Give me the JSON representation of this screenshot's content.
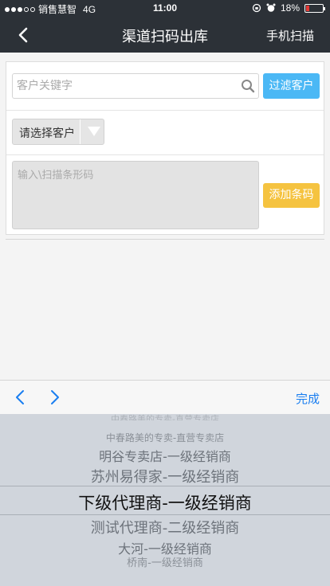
{
  "status_bar": {
    "carrier": "销售慧智",
    "network": "4G",
    "time": "11:00",
    "battery": "18%"
  },
  "nav": {
    "title": "渠道扫码出库",
    "right_action": "手机扫描"
  },
  "form": {
    "search_placeholder": "客户关键字",
    "filter_button": "过滤客户",
    "customer_select": "请选择客户",
    "barcode_placeholder": "输入\\扫描条形码",
    "add_barcode_button": "添加条码"
  },
  "toolbar": {
    "done_label": "完成"
  },
  "picker": {
    "items": [
      "中春路美的专卖-直营专卖店",
      "中春路美的专卖-直营专卖店",
      "明谷专卖店-一级经销商",
      "苏州易得家-一级经销商",
      "下级代理商-一级经销商",
      "测试代理商-二级经销商",
      "大河-一级经销商",
      "桥南-一级经销商"
    ],
    "selected_index": 4
  },
  "colors": {
    "nav_bg": "#2c3137",
    "filter_button": "#4bb8f5",
    "add_button": "#f5c340",
    "done_link": "#1a7ef0",
    "battery_low": "#e53935"
  }
}
